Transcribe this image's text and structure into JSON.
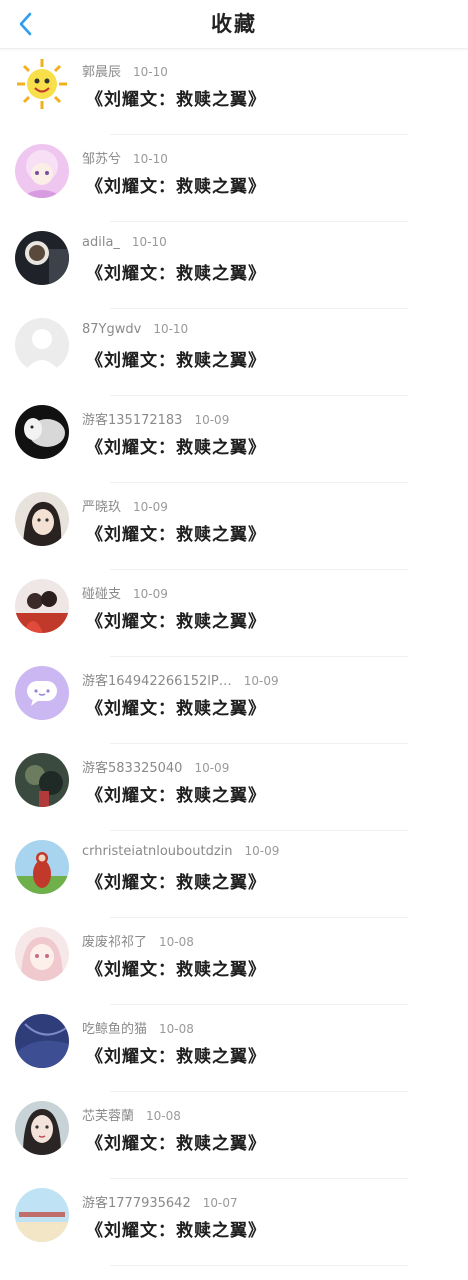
{
  "header": {
    "title": "收藏",
    "back_icon": "chevron-left-icon",
    "accent": "#2a9df4"
  },
  "items": [
    {
      "user": "郭晨辰",
      "date": "10-10",
      "book": "《刘耀文：救赎之翼》",
      "avatar_icon": "sun-avatar",
      "avatar_color": "#f5d33a"
    },
    {
      "user": "邹苏兮",
      "date": "10-10",
      "book": "《刘耀文：救赎之翼》",
      "avatar_icon": "anime-girl-avatar",
      "avatar_color": "#e8b4e6"
    },
    {
      "user": "adila_",
      "date": "10-10",
      "book": "《刘耀文：救赎之翼》",
      "avatar_icon": "dark-photo-avatar",
      "avatar_color": "#2e3440"
    },
    {
      "user": "87Ygwdv",
      "date": "10-10",
      "book": "《刘耀文：救赎之翼》",
      "avatar_icon": "default-person-avatar",
      "avatar_color": "#ececec"
    },
    {
      "user": "游客135172183",
      "date": "10-09",
      "book": "《刘耀文：救赎之翼》",
      "avatar_icon": "bw-photo-avatar",
      "avatar_color": "#222222"
    },
    {
      "user": "严晓玖",
      "date": "10-09",
      "book": "《刘耀文：救赎之翼》",
      "avatar_icon": "girl-photo-avatar",
      "avatar_color": "#d9cfc6"
    },
    {
      "user": "碰碰支",
      "date": "10-09",
      "book": "《刘耀文：救赎之翼》",
      "avatar_icon": "couple-photo-avatar",
      "avatar_color": "#c0392b"
    },
    {
      "user": "游客164942266152lP…",
      "date": "10-09",
      "book": "《刘耀文：救赎之翼》",
      "avatar_icon": "chat-bubble-avatar",
      "avatar_color": "#c9b8f0"
    },
    {
      "user": "游客583325040",
      "date": "10-09",
      "book": "《刘耀文：救赎之翼》",
      "avatar_icon": "dark-art-avatar",
      "avatar_color": "#3b4a3f"
    },
    {
      "user": "crhristeiatnlouboutdzin",
      "date": "10-09",
      "book": "《刘耀文：救赎之翼》",
      "avatar_icon": "teletubby-avatar",
      "avatar_color": "#6fb04a"
    },
    {
      "user": "废废祁祁了",
      "date": "10-08",
      "book": "《刘耀文：救赎之翼》",
      "avatar_icon": "anime-pink-avatar",
      "avatar_color": "#f4dede"
    },
    {
      "user": "吃鲸鱼的猫",
      "date": "10-08",
      "book": "《刘耀文：救赎之翼》",
      "avatar_icon": "blue-fabric-avatar",
      "avatar_color": "#2f3e7a"
    },
    {
      "user": "芯芙蓉蘭",
      "date": "10-08",
      "book": "《刘耀文：救赎之翼》",
      "avatar_icon": "girl-portrait-avatar",
      "avatar_color": "#c7d3d6"
    },
    {
      "user": "游客1777935642",
      "date": "10-07",
      "book": "《刘耀文：救赎之翼》",
      "avatar_icon": "beach-text-avatar",
      "avatar_color": "#bfe3f5"
    }
  ]
}
